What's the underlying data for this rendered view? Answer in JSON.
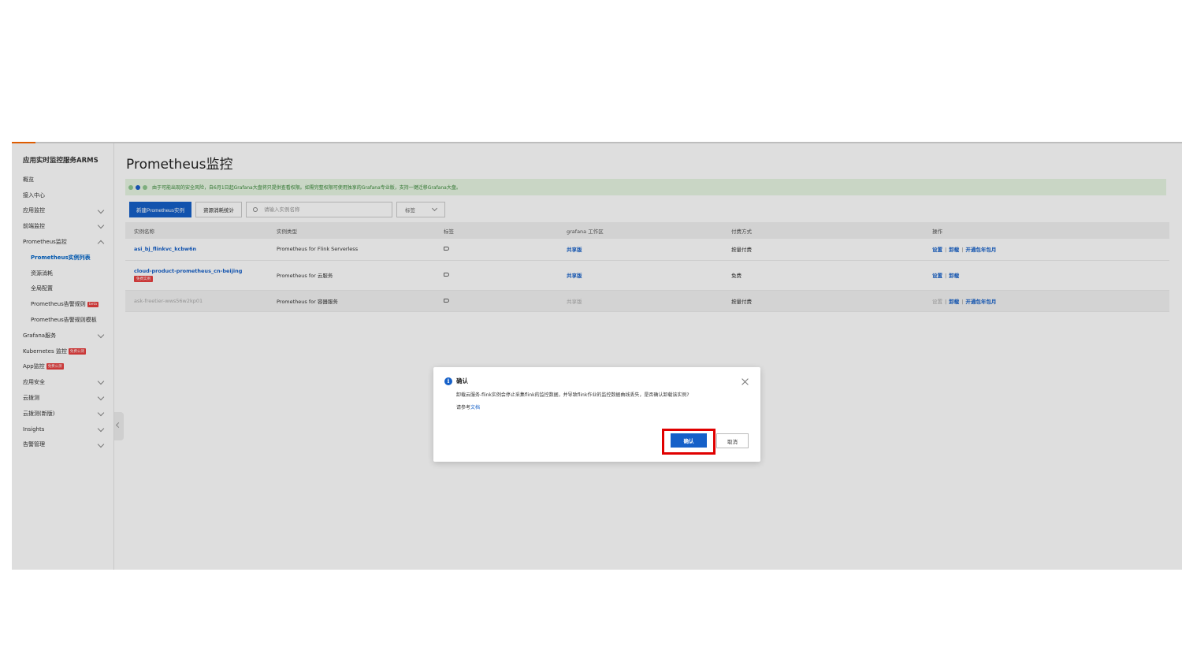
{
  "sidebar": {
    "app_title": "应用实时监控服务ARMS",
    "items": [
      {
        "label": "概览",
        "chevron": ""
      },
      {
        "label": "接入中心",
        "chevron": ""
      },
      {
        "label": "应用监控",
        "chevron": "down"
      },
      {
        "label": "前端监控",
        "chevron": "down"
      },
      {
        "label": "Prometheus监控",
        "chevron": "up"
      },
      {
        "label": "Prometheus实例列表",
        "sub": true,
        "active": true
      },
      {
        "label": "资源消耗",
        "sub": true
      },
      {
        "label": "全局配置",
        "sub": true
      },
      {
        "label": "Prometheus告警规则",
        "sub": true,
        "badge": "beta"
      },
      {
        "label": "Prometheus告警规则模板",
        "sub": true
      },
      {
        "label": "Grafana服务",
        "chevron": "down"
      },
      {
        "label": "Kubernetes 监控",
        "badge": "免费公测"
      },
      {
        "label": "App监控",
        "badge": "免费公测"
      },
      {
        "label": "应用安全",
        "chevron": "down"
      },
      {
        "label": "云拨测",
        "chevron": "down"
      },
      {
        "label": "云拨测(新版)",
        "chevron": "down"
      },
      {
        "label": "Insights",
        "chevron": "down"
      },
      {
        "label": "告警管理",
        "chevron": "down"
      }
    ]
  },
  "main": {
    "title": "Prometheus监控",
    "notice": "由于可能出现的安全风险，自6月1日起Grafana大盘将只提供查看权限。如需完整权限可使用独享的Grafana专业版，支持一键迁移Grafana大盘。",
    "toolbar": {
      "create_label": "新建Prometheus实例",
      "stats_label": "资源消耗统计",
      "search_placeholder": "请输入实例名称",
      "tag_select": "标签"
    },
    "table": {
      "headers": [
        "实例名称",
        "实例类型",
        "标签",
        "grafana 工作区",
        "付费方式",
        "操作"
      ],
      "rows": [
        {
          "name": "asi_bj_flinkvc_kcbw6n",
          "type": "Prometheus for Flink Serverless",
          "grafana": "共享版",
          "billing": "按量付费",
          "ops": [
            "设置",
            "卸载",
            "开通包年包月"
          ],
          "disabled": false
        },
        {
          "name": "cloud-product-prometheus_cn-beijing",
          "badge": "免费实例",
          "type": "Prometheus for 云服务",
          "grafana": "共享版",
          "billing": "免费",
          "ops": [
            "设置",
            "卸载"
          ],
          "disabled": false
        },
        {
          "name": "ask-freetier-wws56w2kp01",
          "type": "Prometheus for 容器服务",
          "grafana": "共享版",
          "billing": "按量付费",
          "ops": [
            "设置",
            "卸载",
            "开通包年包月"
          ],
          "disabled": true
        }
      ]
    }
  },
  "dialog": {
    "title": "确认",
    "body": "卸载云服务-flink实例会停止采集flink的监控数据，并导致flink作业的监控数据曲线丢失，是否确认卸载该实例?",
    "ref_prefix": "请参考",
    "ref_link": "文档",
    "confirm_label": "确认",
    "cancel_label": "取消"
  }
}
